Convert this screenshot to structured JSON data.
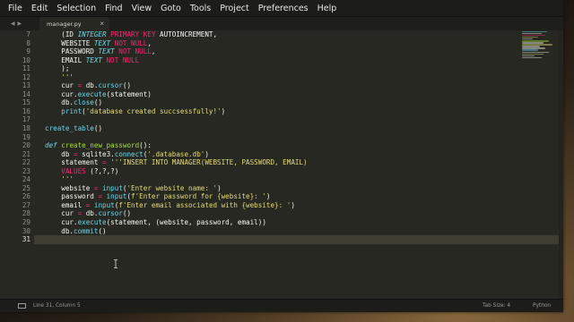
{
  "menu": [
    "File",
    "Edit",
    "Selection",
    "Find",
    "View",
    "Goto",
    "Tools",
    "Project",
    "Preferences",
    "Help"
  ],
  "tab": {
    "title": "manager.py",
    "close": "×"
  },
  "nav": {
    "left": "◀",
    "right": "▶"
  },
  "editor": {
    "line_numbers": [
      "7",
      "8",
      "9",
      "10",
      "11",
      "12",
      "13",
      "14",
      "15",
      "16",
      "17",
      "18",
      "19",
      "20",
      "21",
      "22",
      "23",
      "24",
      "25",
      "26",
      "27",
      "28",
      "29",
      "30",
      "31"
    ],
    "current_line": "31"
  },
  "status": {
    "position": "Line 31, Column 5",
    "tab_size": "Tab Size: 4",
    "syntax": "Python"
  },
  "colors": {
    "keyword": "#f92672",
    "type": "#66d9ef",
    "string": "#e6db74",
    "function": "#a6e22e",
    "background": "#272822"
  }
}
